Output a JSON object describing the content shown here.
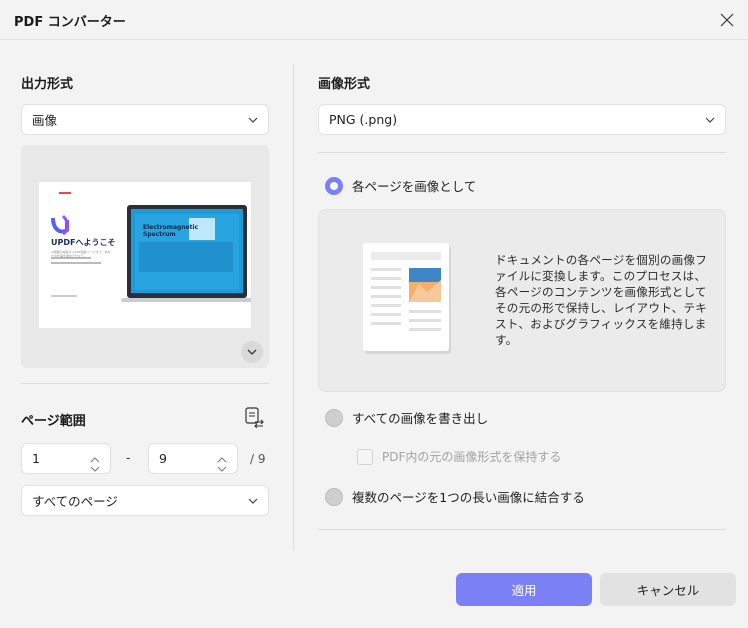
{
  "window": {
    "title": "PDF コンバーター"
  },
  "left": {
    "output_format_label": "出力形式",
    "output_format_value": "画像",
    "preview": {
      "doc_title": "UPDFへようこそ",
      "doc_subtitle": "AI搭載の編集からPDF編集ツールまで、あなたの仕事を進化させよう。",
      "laptop_heading": "Electromagnetic Spectrum"
    },
    "page_range_label": "ページ範囲",
    "range_from": "1",
    "range_dash": "-",
    "range_to": "9",
    "range_total": "/ 9",
    "page_subset_value": "すべてのページ"
  },
  "right": {
    "image_format_label": "画像形式",
    "image_format_value": "PNG (.png)",
    "options": [
      {
        "label": "各ページを画像として",
        "selected": true
      },
      {
        "label": "すべての画像を書き出し",
        "selected": false
      },
      {
        "label": "複数のページを1つの長い画像に結合する",
        "selected": false
      }
    ],
    "description": "ドキュメントの各ページを個別の画像ファイルに変換します。このプロセスは、各ページのコンテンツを画像形式としてその元の形で保持し、レイアウト、テキスト、およびグラフィックスを維持します。",
    "keep_format_checkbox": "PDF内の元の画像形式を保持する"
  },
  "footer": {
    "apply_label": "適用",
    "cancel_label": "キャンセル"
  },
  "colors": {
    "accent": "#7b80f5",
    "background": "#f3f3f3"
  }
}
